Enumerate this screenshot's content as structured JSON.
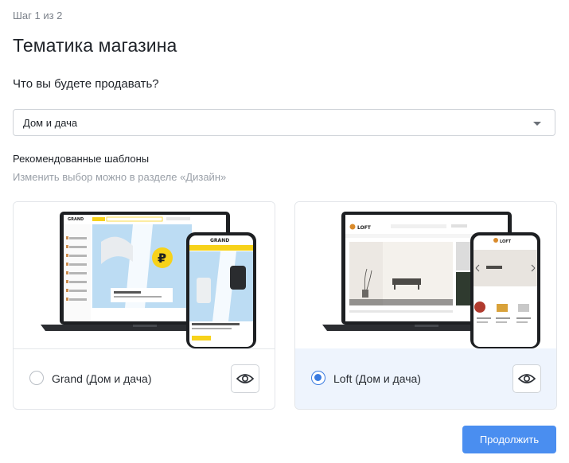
{
  "header": {
    "step": "Шаг 1 из 2",
    "title": "Тематика магазина",
    "question": "Что вы будете продавать?"
  },
  "category_select": {
    "value": "Дом и дача"
  },
  "recommended": {
    "title": "Рекомендованные шаблоны",
    "subtitle": "Изменить выбор можно в разделе «Дизайн»"
  },
  "templates": [
    {
      "label": "Grand (Дом и дача)",
      "selected": false,
      "preview_logo": "GRAND",
      "preview_currency": "₽"
    },
    {
      "label": "Loft (Дом и дача)",
      "selected": true,
      "preview_logo": "LOFT"
    }
  ],
  "actions": {
    "continue_label": "Продолжить"
  },
  "colors": {
    "primary": "#4a8ef0",
    "selected_bg": "#eef4fd",
    "grand_accent": "#f7d21a",
    "grand_banner": "#bcdcf3"
  }
}
